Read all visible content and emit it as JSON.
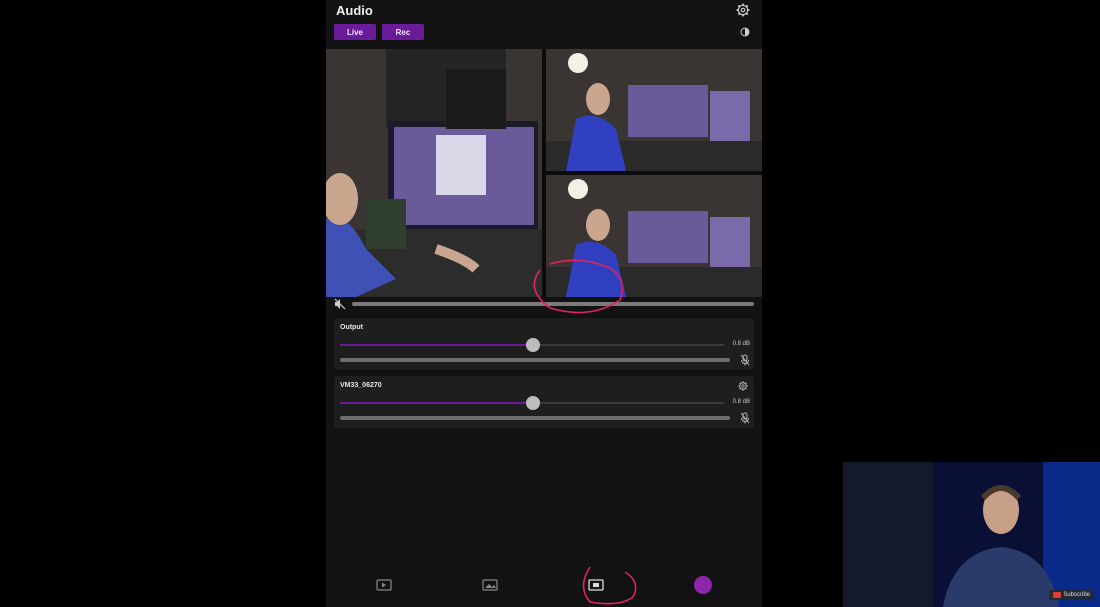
{
  "app": {
    "title": "Audio",
    "buttons": {
      "live": "Live",
      "rec": "Rec"
    }
  },
  "tracks": [
    {
      "name": "Output",
      "db": "0.8 dB",
      "volume_fraction": 0.5
    },
    {
      "name": "VM33_06270",
      "db": "0.8 dB",
      "volume_fraction": 0.5
    }
  ],
  "icons": {
    "settings": "gear-icon",
    "theme": "contrast-icon",
    "mute": "speaker-muted-icon",
    "mic_mute": "mic-muted-icon",
    "tabs": [
      "video-icon",
      "image-icon",
      "overlay-icon",
      "add-icon"
    ]
  },
  "overlay": {
    "subscribe": "Subscribe"
  },
  "colors": {
    "accent": "#6a1b9a",
    "annotation": "#e0245e"
  }
}
